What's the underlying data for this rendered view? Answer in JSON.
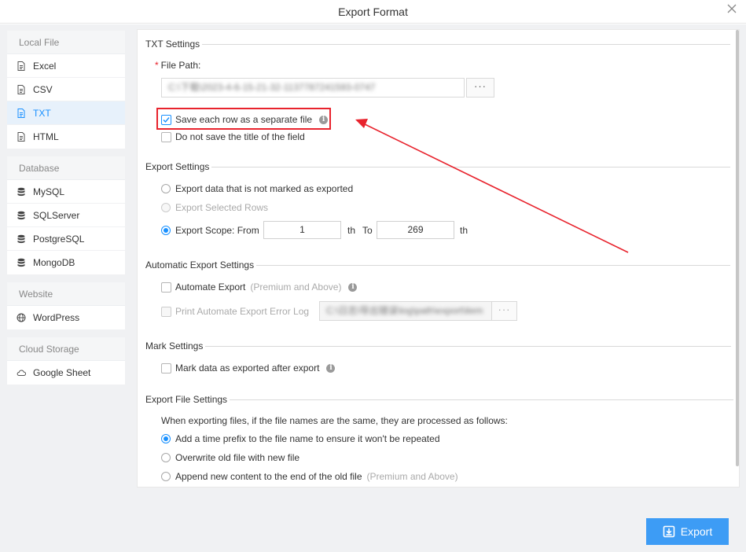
{
  "dialog": {
    "title": "Export Format"
  },
  "sidebar": {
    "groups": [
      {
        "title": "Local File",
        "items": [
          {
            "label": "Excel",
            "icon": "file-icon"
          },
          {
            "label": "CSV",
            "icon": "file-icon"
          },
          {
            "label": "TXT",
            "icon": "file-icon",
            "active": true
          },
          {
            "label": "HTML",
            "icon": "file-icon"
          }
        ]
      },
      {
        "title": "Database",
        "items": [
          {
            "label": "MySQL",
            "icon": "database-icon"
          },
          {
            "label": "SQLServer",
            "icon": "database-icon"
          },
          {
            "label": "PostgreSQL",
            "icon": "database-icon"
          },
          {
            "label": "MongoDB",
            "icon": "database-icon"
          }
        ]
      },
      {
        "title": "Website",
        "items": [
          {
            "label": "WordPress",
            "icon": "globe-icon"
          }
        ]
      },
      {
        "title": "Cloud Storage",
        "items": [
          {
            "label": "Google Sheet",
            "icon": "cloud-icon"
          }
        ]
      }
    ]
  },
  "txt_settings": {
    "heading": "TXT Settings",
    "file_path_label": "File Path:",
    "required_mark": "*",
    "file_path_value": "C:\\下载\\2023-4-6-15-21-32-1137787241593-0747",
    "browse_label": "···",
    "save_each_row": {
      "label": "Save each row as a separate file",
      "checked": true
    },
    "no_title": {
      "label": "Do not save the title of the field",
      "checked": false
    }
  },
  "export_settings": {
    "heading": "Export Settings",
    "option_unmarked": "Export data that is not marked as exported",
    "option_selected": "Export Selected Rows",
    "option_scope": "Export Scope: From",
    "scope_from": "1",
    "scope_th1": "th",
    "scope_to_label": "To",
    "scope_to": "269",
    "scope_th2": "th",
    "selected": "scope"
  },
  "auto_export": {
    "heading": "Automatic Export Settings",
    "automate_label": "Automate Export",
    "automate_note": "(Premium and Above)",
    "error_log_label": "Print Automate Export Error Log",
    "error_log_path": "C:\\日志\\导出错误\\log\\path\\export\\item",
    "browse_label": "···"
  },
  "mark_settings": {
    "heading": "Mark Settings",
    "mark_label": "Mark data as exported after export"
  },
  "file_settings": {
    "heading": "Export File Settings",
    "description": "When exporting files, if the file names are the same, they are processed as follows:",
    "option_prefix": "Add a time prefix to the file name to ensure it won't be repeated",
    "option_overwrite": "Overwrite old file with new file",
    "option_append": "Append new content to the end of the old file",
    "append_note": "(Premium and Above)",
    "selected": "prefix"
  },
  "footer": {
    "export_label": "Export"
  },
  "colors": {
    "accent": "#1890ff",
    "button": "#3d9cf5",
    "annotation": "#e8232d",
    "sidebar_bg": "#f0f1f3"
  }
}
